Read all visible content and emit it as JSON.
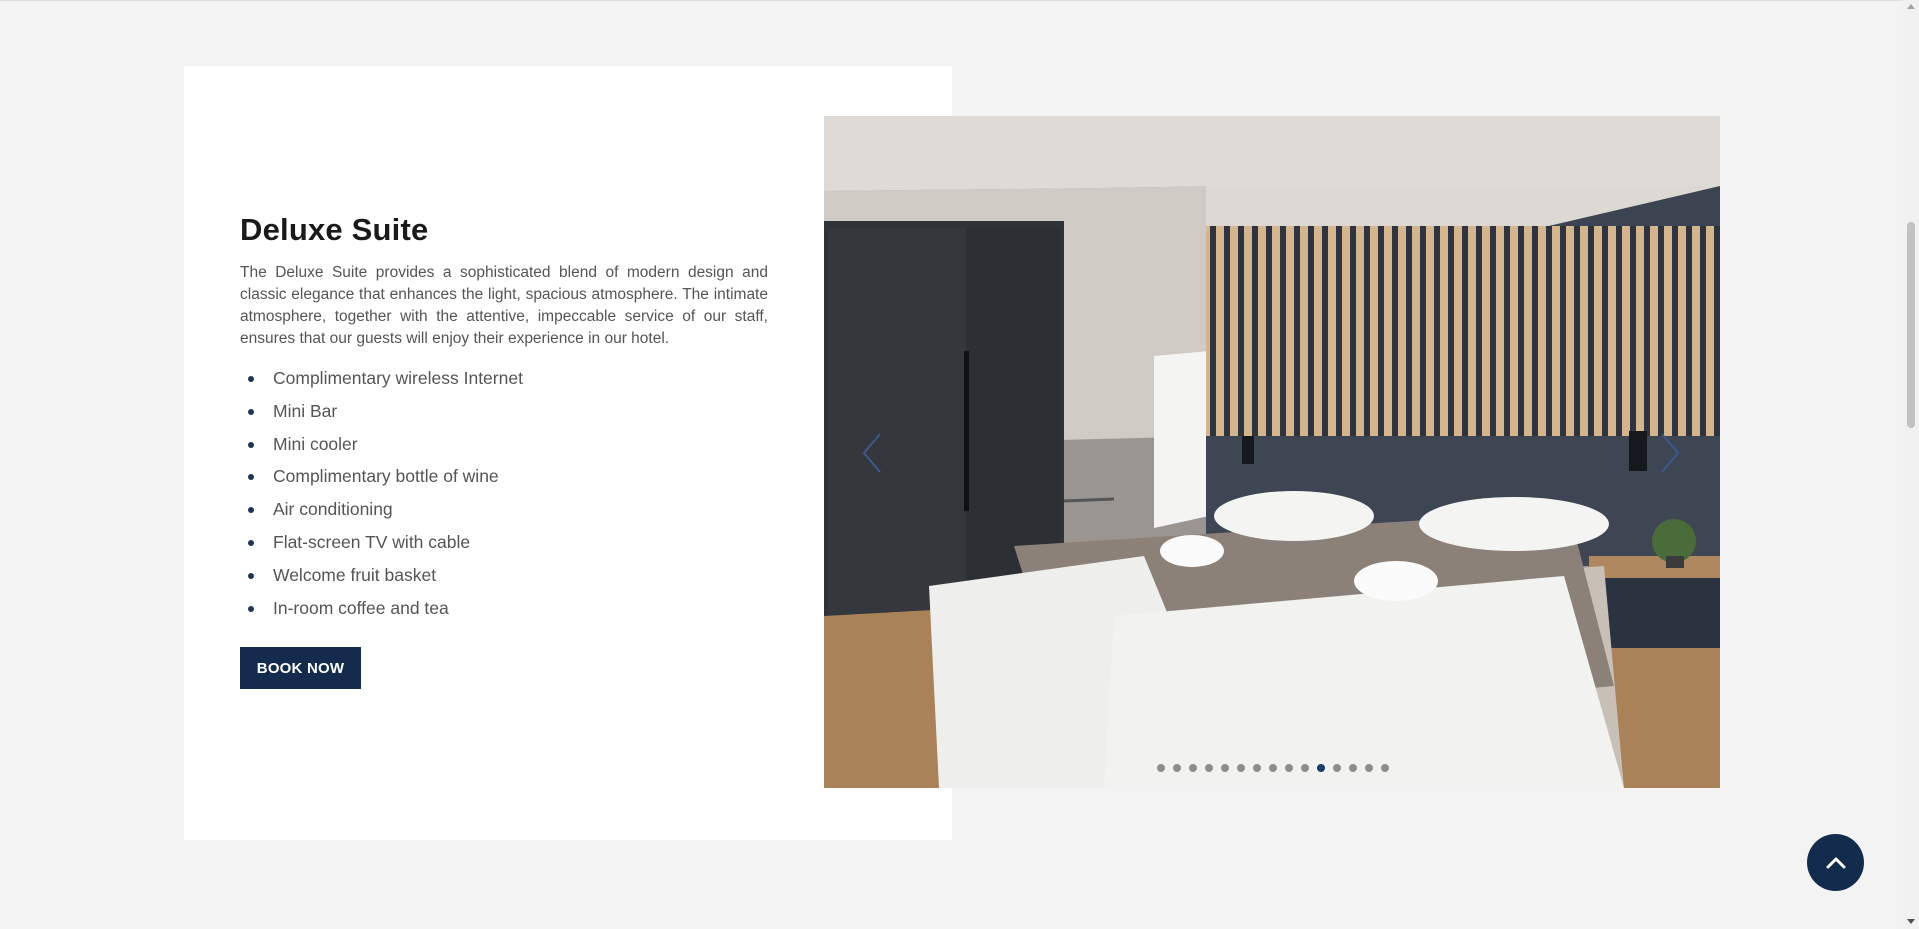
{
  "room": {
    "title": "Deluxe Suite",
    "description": "The Deluxe Suite provides a sophisticated blend of modern design and classic elegance that enhances the light, spacious atmosphere. The intimate atmosphere, together with the attentive, impeccable service of our staff, ensures that our guests will enjoy their experience in our hotel.",
    "amenities": [
      "Complimentary wireless Internet",
      "Mini Bar",
      "Mini cooler",
      "Complimentary bottle of wine",
      "Air conditioning",
      "Flat-screen TV with cable",
      "Welcome fruit basket",
      "In-room coffee and tea"
    ],
    "book_label": "BOOK NOW"
  },
  "slider": {
    "total_slides": 15,
    "active_slide": 11,
    "prev_icon": "chevron-left-icon",
    "next_icon": "chevron-right-icon"
  },
  "colors": {
    "accent": "#142b4d",
    "page_bg": "#f3f3f3",
    "card_bg": "#ffffff",
    "active_dot": "#1d3c6e"
  },
  "back_to_top_icon": "chevron-up-icon"
}
